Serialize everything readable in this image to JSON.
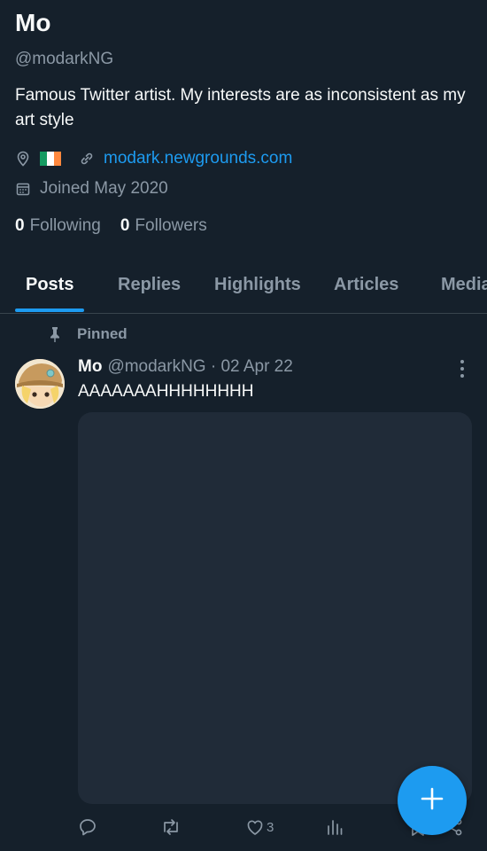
{
  "profile": {
    "name": "Mo",
    "handle": "@modarkNG",
    "bio": "Famous Twitter artist. My interests are as inconsistent as my art style",
    "location_icon": "location-pin-icon",
    "flag": "ireland-flag",
    "website": "modark.newgrounds.com",
    "joined": "Joined May 2020",
    "following_count": "0",
    "following_label": "Following",
    "followers_count": "0",
    "followers_label": "Followers"
  },
  "tabs": [
    {
      "label": "Posts",
      "active": true
    },
    {
      "label": "Replies",
      "active": false
    },
    {
      "label": "Highlights",
      "active": false
    },
    {
      "label": "Articles",
      "active": false
    },
    {
      "label": "Media",
      "active": false
    }
  ],
  "pinned_label": "Pinned",
  "tweet": {
    "name": "Mo",
    "handle_date": "@modarkNG · 02 Apr 22",
    "text": "AAAAAAAHHHHHHHH",
    "likes": "3"
  },
  "colors": {
    "background": "#15202b",
    "accent": "#1d9bf0",
    "muted": "#8b98a5",
    "media_placeholder": "#202b38"
  },
  "fab_icon": "plus-icon"
}
